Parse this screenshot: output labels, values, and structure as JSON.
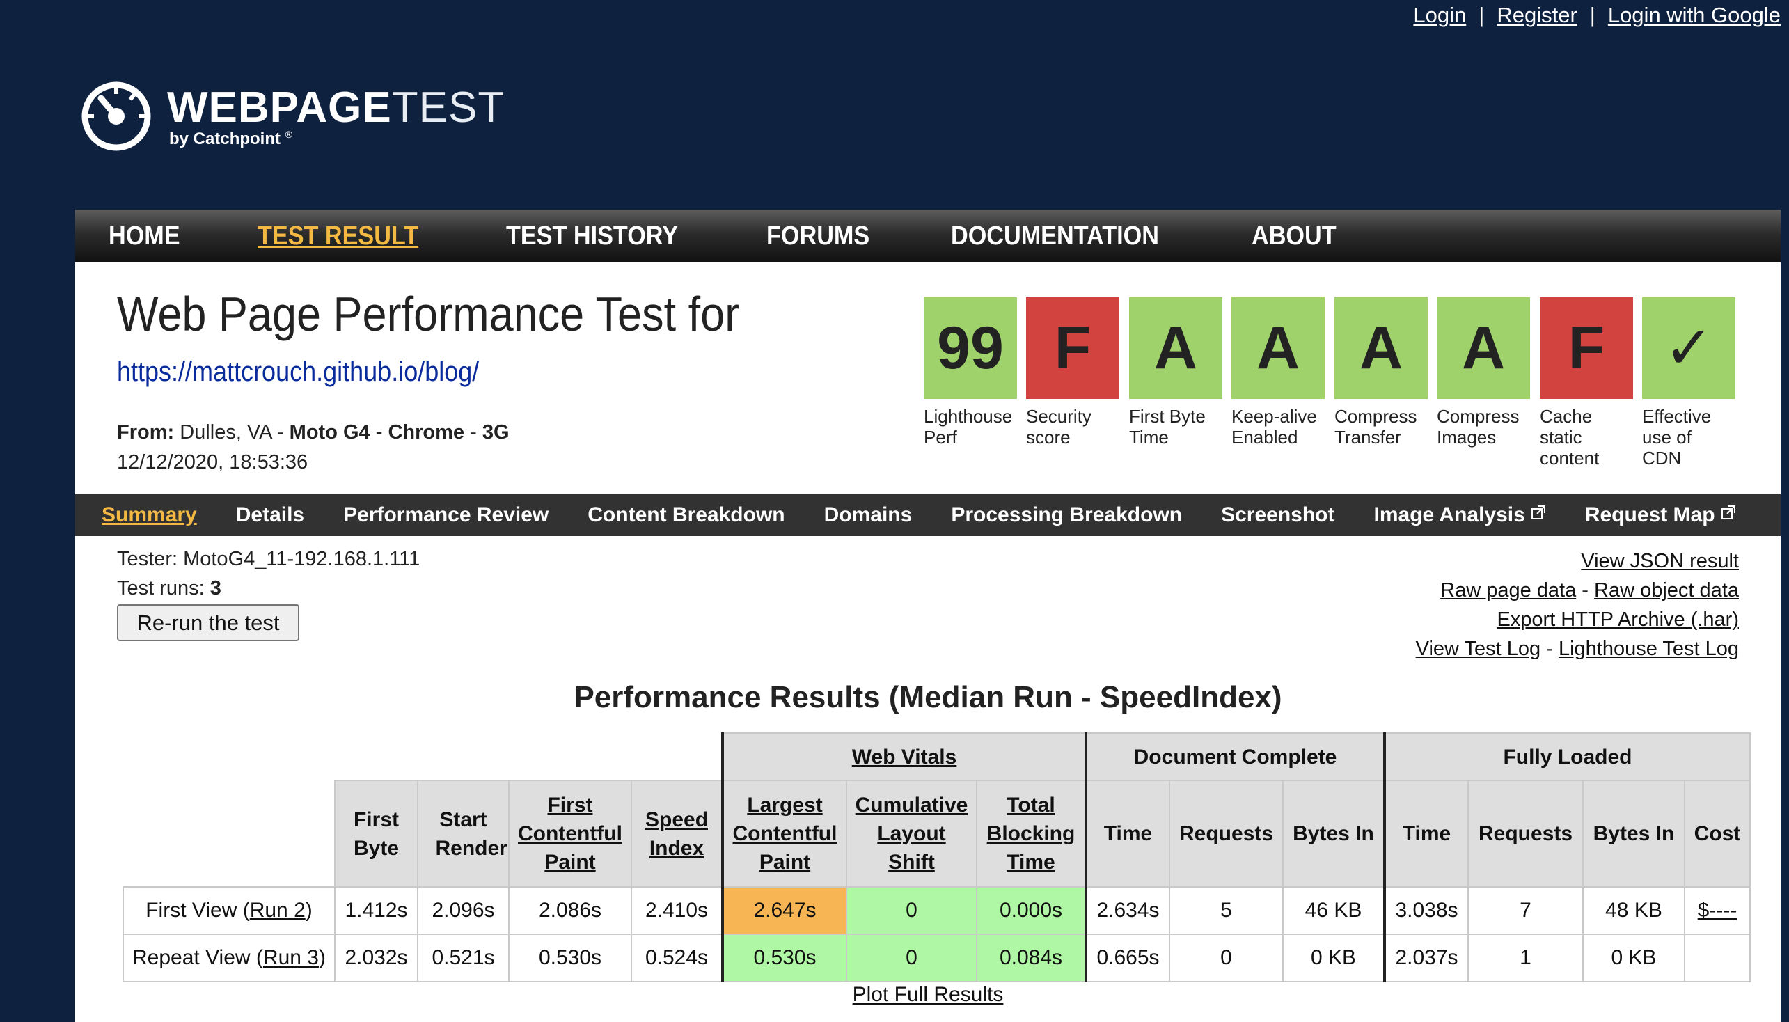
{
  "top_links": {
    "login": "Login",
    "register": "Register",
    "login_google": "Login with Google",
    "separator": "|"
  },
  "logo": {
    "word_bold": "WEBPAGE",
    "word_light": "TEST",
    "byline": "by Catchpoint",
    "reg": "®"
  },
  "main_nav": {
    "home": "HOME",
    "test_result": "TEST RESULT",
    "test_history": "TEST HISTORY",
    "forums": "FORUMS",
    "documentation": "DOCUMENTATION",
    "about": "ABOUT"
  },
  "header": {
    "title": "Web Page Performance Test for",
    "url": "https://mattcrouch.github.io/blog/",
    "from_label": "From:",
    "from_location": "Dulles, VA",
    "device": "Moto G4",
    "browser": "Chrome",
    "connection": "3G",
    "dash": "-",
    "date": "12/12/2020, 18:53:36"
  },
  "grades": [
    {
      "value": "99",
      "label": "Lighthouse Perf",
      "color": "#9fd26a"
    },
    {
      "value": "F",
      "label": "Security score",
      "color": "#d2433f"
    },
    {
      "value": "A",
      "label": "First Byte Time",
      "color": "#9fd26a"
    },
    {
      "value": "A",
      "label": "Keep-alive Enabled",
      "color": "#9fd26a"
    },
    {
      "value": "A",
      "label": "Compress Transfer",
      "color": "#9fd26a"
    },
    {
      "value": "A",
      "label": "Compress Images",
      "color": "#9fd26a"
    },
    {
      "value": "F",
      "label": "Cache static content",
      "color": "#d2433f"
    },
    {
      "value": "✓",
      "label": "Effective use of CDN",
      "color": "#9fd26a"
    }
  ],
  "sub_nav": {
    "summary": "Summary",
    "details": "Details",
    "performance_review": "Performance Review",
    "content_breakdown": "Content Breakdown",
    "domains": "Domains",
    "processing_breakdown": "Processing Breakdown",
    "screenshot": "Screenshot",
    "image_analysis": "Image Analysis",
    "request_map": "Request Map"
  },
  "test_info": {
    "tester_label": "Tester:",
    "tester": "MotoG4_11-192.168.1.111",
    "runs_label": "Test runs:",
    "runs": "3",
    "rerun_button": "Re-run the test"
  },
  "right_links": {
    "view_json": "View JSON result",
    "raw_page": "Raw page data",
    "raw_object": "Raw object data",
    "export_har": "Export HTTP Archive (.har)",
    "view_log": "View Test Log",
    "lighthouse_log": "Lighthouse Test Log",
    "dash": "-"
  },
  "results": {
    "heading": "Performance Results (Median Run - SpeedIndex)",
    "groups": {
      "web_vitals": "Web Vitals",
      "document_complete": "Document Complete",
      "fully_loaded": "Fully Loaded"
    },
    "cols": {
      "first_byte": "First Byte",
      "start_render": "Start Render",
      "fcp": "First Contentful Paint",
      "speed_index": "Speed Index",
      "lcp": "Largest Contentful Paint",
      "cls": "Cumulative Layout Shift",
      "tbt": "Total Blocking Time",
      "time": "Time",
      "requests": "Requests",
      "bytes_in": "Bytes In",
      "cost": "Cost"
    },
    "rows": [
      {
        "label": "First View (",
        "run": "Run 2",
        "close": ")",
        "first_byte": "1.412s",
        "start_render": "2.096s",
        "fcp": "2.086s",
        "speed_index": "2.410s",
        "lcp": "2.647s",
        "cls": "0",
        "tbt": "0.000s",
        "dc_time": "2.634s",
        "dc_requests": "5",
        "dc_bytes": "46 KB",
        "fl_time": "3.038s",
        "fl_requests": "7",
        "fl_bytes": "48 KB",
        "cost": "$----"
      },
      {
        "label": "Repeat View (",
        "run": "Run 3",
        "close": ")",
        "first_byte": "2.032s",
        "start_render": "0.521s",
        "fcp": "0.530s",
        "speed_index": "0.524s",
        "lcp": "0.530s",
        "cls": "0",
        "tbt": "0.084s",
        "dc_time": "0.665s",
        "dc_requests": "0",
        "dc_bytes": "0 KB",
        "fl_time": "2.037s",
        "fl_requests": "1",
        "fl_bytes": "0 KB",
        "cost": ""
      }
    ],
    "plot_link": "Plot Full Results"
  }
}
